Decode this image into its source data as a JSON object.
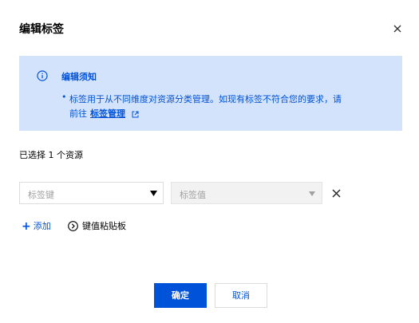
{
  "dialog": {
    "title": "编辑标签",
    "close_icon": "close-icon"
  },
  "notice": {
    "icon": "info-icon",
    "title": "编辑须知",
    "line1": "标签用于从不同维度对资源分类管理。如现有标签不符合您的要求，请",
    "line2_prefix": "前往",
    "link_label": "标签管理",
    "link_icon": "external-link-icon"
  },
  "selection": {
    "count_text": "已选择 1 个资源"
  },
  "tag_row": {
    "key_placeholder": "标签键",
    "value_placeholder": "标签值"
  },
  "actions": {
    "add_label": "添加",
    "clipboard_label": "键值粘贴板"
  },
  "footer": {
    "confirm_label": "确定",
    "cancel_label": "取消"
  },
  "colors": {
    "accent": "#0052d9",
    "notice_bg": "#d4e3fc"
  }
}
